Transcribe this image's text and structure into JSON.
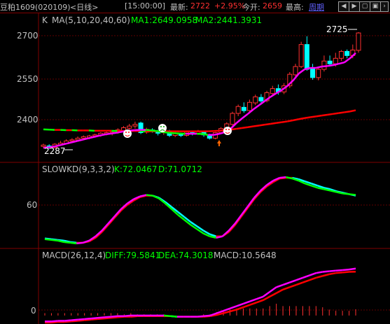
{
  "header": {
    "stock": "豆粕1609(020109)",
    "period": "<日线>",
    "time": "[15:00:00]",
    "latest_label": "最新:",
    "latest": "2722",
    "change": "+2.95%",
    "open_label": "今开:",
    "open": "2659",
    "high_label": "最高:",
    "week_label": "周期",
    "colors": {
      "up": "#ff3030",
      "text": "#c0c0c0",
      "link": "#6060ff"
    },
    "nav_icons": [
      "arrow-left-icon",
      "arrow-right-icon",
      "zoom-out-icon",
      "zoom-in-icon",
      "arrow-right-small-icon"
    ]
  },
  "panels": {
    "main": {
      "prefix": "K",
      "ma_label": "MA(5,10,20,40,60)",
      "ma1": "MA1:2649.0958",
      "ma2": "MA2:2441.3931",
      "yticks": [
        "2700",
        "2550",
        "2400"
      ],
      "max_label": "2725",
      "min_label": "2287"
    },
    "kd": {
      "label": "SLOWKD(9,3,3,2)",
      "k": "K:72.0467",
      "d": "D:71.0712",
      "yticks": [
        "60"
      ]
    },
    "macd": {
      "label": "MACD(26,12,4)",
      "diff": "DIFF:79.5841",
      "dea": "DEA:74.3018",
      "macd": "MACD:10.5648",
      "yticks": [
        "0"
      ]
    }
  },
  "chart_data": [
    {
      "type": "candlestick",
      "title": "K MA(5,10,20,40,60)",
      "ylim": [
        2270,
        2740
      ],
      "yticks": [
        2400,
        2550,
        2700
      ],
      "candles": [
        [
          2310,
          2315,
          2305,
          2320
        ],
        [
          2312,
          2306,
          2300,
          2318
        ],
        [
          2306,
          2318,
          2302,
          2322
        ],
        [
          2316,
          2322,
          2312,
          2330
        ],
        [
          2320,
          2330,
          2318,
          2336
        ],
        [
          2330,
          2334,
          2325,
          2340
        ],
        [
          2334,
          2340,
          2330,
          2346
        ],
        [
          2340,
          2345,
          2335,
          2350
        ],
        [
          2342,
          2348,
          2336,
          2352
        ],
        [
          2348,
          2352,
          2342,
          2356
        ],
        [
          2350,
          2358,
          2345,
          2362
        ],
        [
          2356,
          2360,
          2350,
          2365
        ],
        [
          2358,
          2362,
          2350,
          2368
        ],
        [
          2362,
          2370,
          2356,
          2376
        ],
        [
          2368,
          2378,
          2362,
          2384
        ],
        [
          2376,
          2384,
          2370,
          2392
        ],
        [
          2384,
          2390,
          2375,
          2400
        ],
        [
          2395,
          2360,
          2355,
          2400
        ],
        [
          2362,
          2372,
          2356,
          2378
        ],
        [
          2370,
          2366,
          2360,
          2376
        ],
        [
          2366,
          2358,
          2350,
          2370
        ],
        [
          2360,
          2366,
          2352,
          2370
        ],
        [
          2366,
          2350,
          2344,
          2370
        ],
        [
          2350,
          2358,
          2344,
          2362
        ],
        [
          2356,
          2350,
          2344,
          2360
        ],
        [
          2350,
          2362,
          2346,
          2366
        ],
        [
          2360,
          2358,
          2350,
          2366
        ],
        [
          2358,
          2364,
          2352,
          2370
        ],
        [
          2364,
          2352,
          2345,
          2368
        ],
        [
          2350,
          2340,
          2335,
          2356
        ],
        [
          2340,
          2360,
          2336,
          2362
        ],
        [
          2360,
          2375,
          2356,
          2380
        ],
        [
          2374,
          2392,
          2370,
          2398
        ],
        [
          2390,
          2430,
          2386,
          2436
        ],
        [
          2430,
          2455,
          2420,
          2462
        ],
        [
          2452,
          2440,
          2432,
          2470
        ],
        [
          2440,
          2470,
          2434,
          2480
        ],
        [
          2468,
          2490,
          2460,
          2498
        ],
        [
          2488,
          2475,
          2462,
          2500
        ],
        [
          2476,
          2505,
          2470,
          2512
        ],
        [
          2502,
          2520,
          2495,
          2530
        ],
        [
          2520,
          2508,
          2498,
          2535
        ],
        [
          2508,
          2530,
          2500,
          2540
        ],
        [
          2530,
          2572,
          2522,
          2580
        ],
        [
          2570,
          2600,
          2560,
          2610
        ],
        [
          2600,
          2680,
          2595,
          2690
        ],
        [
          2680,
          2590,
          2585,
          2710
        ],
        [
          2592,
          2560,
          2552,
          2610
        ],
        [
          2560,
          2590,
          2550,
          2600
        ],
        [
          2590,
          2620,
          2582,
          2640
        ],
        [
          2620,
          2610,
          2600,
          2640
        ],
        [
          2610,
          2630,
          2600,
          2650
        ],
        [
          2630,
          2655,
          2620,
          2660
        ],
        [
          2655,
          2640,
          2630,
          2662
        ],
        [
          2640,
          2660,
          2630,
          2680
        ],
        [
          2659,
          2722,
          2650,
          2725
        ]
      ],
      "series": [
        {
          "name": "MA1",
          "values": [
            2305,
            2307,
            2310,
            2315,
            2320,
            2325,
            2330,
            2335,
            2340,
            2345,
            2350,
            2354,
            2357,
            2360,
            2364,
            2367,
            2369,
            2370,
            2370,
            2368,
            2366,
            2362,
            2360,
            2358,
            2357,
            2356,
            2356,
            2356,
            2355,
            2352,
            2352,
            2356,
            2362,
            2375,
            2395,
            2412,
            2428,
            2445,
            2460,
            2475,
            2490,
            2503,
            2515,
            2530,
            2550,
            2575,
            2590,
            2595,
            2595,
            2600,
            2602,
            2605,
            2610,
            2615,
            2630,
            2649.0958
          ]
        },
        {
          "name": "MA2",
          "values": [
            2372,
            2371,
            2370,
            2370,
            2369,
            2369,
            2368,
            2368,
            2368,
            2367,
            2367,
            2367,
            2367,
            2366,
            2366,
            2366,
            2366,
            2366,
            2365,
            2365,
            2365,
            2365,
            2365,
            2365,
            2365,
            2365,
            2365,
            2365,
            2365,
            2365,
            2366,
            2367,
            2369,
            2371,
            2374,
            2377,
            2380,
            2383,
            2386,
            2389,
            2392,
            2395,
            2398,
            2401,
            2405,
            2409,
            2413,
            2416,
            2419,
            2422,
            2425,
            2428,
            2431,
            2434,
            2437,
            2441.3931
          ]
        }
      ],
      "annotations": [
        "2725",
        "2287"
      ]
    },
    {
      "type": "line",
      "title": "SLOWKD(9,3,3,2)",
      "yticks": [
        60
      ],
      "ylim": [
        0,
        100
      ],
      "series": [
        {
          "name": "K",
          "values": [
            10,
            9,
            8,
            6,
            5,
            4,
            5,
            8,
            14,
            22,
            32,
            42,
            52,
            60,
            66,
            70,
            72,
            71,
            67,
            60,
            52,
            44,
            37,
            30,
            24,
            18,
            14,
            12,
            14,
            22,
            32,
            44,
            56,
            68,
            78,
            86,
            92,
            96,
            97,
            95,
            92,
            88,
            85,
            82,
            80,
            78,
            76,
            74,
            73,
            72.0467
          ]
        },
        {
          "name": "D",
          "values": [
            11,
            10,
            9,
            8,
            6,
            5,
            5,
            7,
            12,
            20,
            30,
            40,
            50,
            58,
            64,
            69,
            71,
            71,
            68,
            62,
            55,
            48,
            41,
            34,
            28,
            22,
            17,
            14,
            14,
            20,
            30,
            42,
            54,
            66,
            76,
            84,
            90,
            95,
            96,
            96,
            94,
            91,
            88,
            85,
            82,
            80,
            77,
            75,
            73,
            71.0712
          ]
        }
      ]
    },
    {
      "type": "line",
      "title": "MACD(26,12,4)",
      "yticks": [
        0
      ],
      "ylim": [
        -12,
        90
      ],
      "series": [
        {
          "name": "DIFF",
          "values": [
            -10,
            -10,
            -9,
            -9,
            -8,
            -7,
            -6,
            -5,
            -4,
            -3,
            -2,
            -1,
            -1,
            0,
            0,
            0,
            0,
            0,
            0,
            -1,
            -2,
            -2,
            -2,
            -2,
            -1,
            0,
            4,
            8,
            12,
            16,
            20,
            24,
            28,
            32,
            40,
            48,
            52,
            56,
            60,
            64,
            68,
            72,
            74,
            75,
            76,
            77,
            78,
            79.5841
          ]
        },
        {
          "name": "DEA",
          "values": [
            -12,
            -12,
            -11,
            -11,
            -10,
            -9,
            -8,
            -7,
            -6,
            -5,
            -4,
            -3,
            -2,
            -2,
            -1,
            -1,
            -1,
            -1,
            -1,
            -1,
            -2,
            -2,
            -2,
            -2,
            -2,
            -1,
            1,
            4,
            7,
            10,
            14,
            18,
            22,
            26,
            32,
            38,
            44,
            48,
            52,
            56,
            60,
            64,
            67,
            70,
            72,
            73,
            74,
            74.3018
          ]
        }
      ]
    }
  ]
}
